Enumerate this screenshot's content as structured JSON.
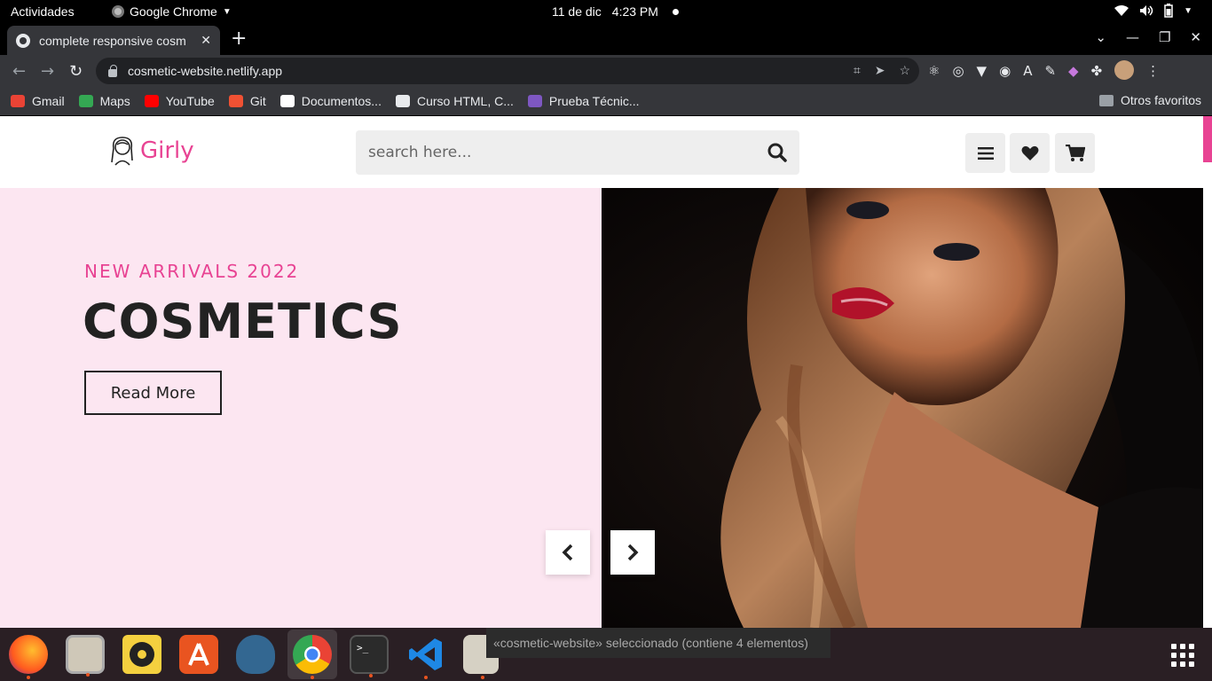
{
  "os_bar": {
    "activities": "Actividades",
    "app_name": "Google Chrome",
    "date": "11 de dic",
    "time": "4:23 PM"
  },
  "browser": {
    "tab_title": "complete responsive cosm",
    "url": "cosmetic-website.netlify.app",
    "bookmarks": [
      {
        "label": "Gmail",
        "color": "#ea4335"
      },
      {
        "label": "Maps",
        "color": "#34a853"
      },
      {
        "label": "YouTube",
        "color": "#ff0000"
      },
      {
        "label": "Git",
        "color": "#f05133"
      },
      {
        "label": "Documentos...",
        "color": "#ffffff"
      },
      {
        "label": "Curso HTML, C...",
        "color": "#e8eaed"
      },
      {
        "label": "Prueba Técnic...",
        "color": "#7e57c2"
      }
    ],
    "other_bookmarks": "Otros favoritos"
  },
  "site": {
    "brand": "Girly",
    "search_placeholder": "search here...",
    "hero": {
      "subtitle": "NEW ARRIVALS 2022",
      "title": "COSMETICS",
      "cta": "Read More"
    }
  },
  "dock": {
    "toast": "«cosmetic-website» seleccionado  (contiene 4 elementos)"
  },
  "colors": {
    "accent": "#e84393",
    "hero_bg": "#fce6f1"
  }
}
